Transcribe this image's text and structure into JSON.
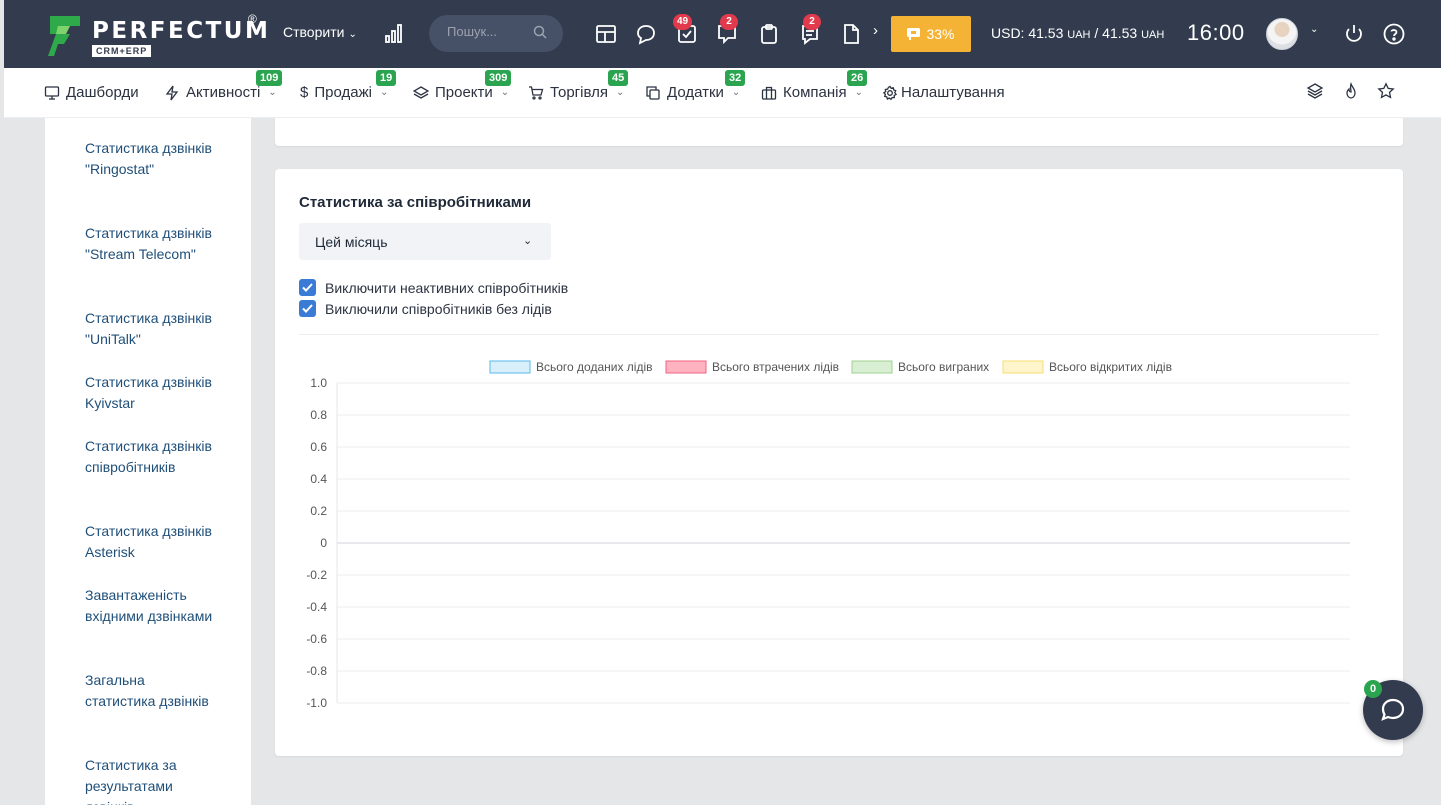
{
  "topbar": {
    "logo_text": "PERFECTUM",
    "logo_reg": "®",
    "logo_sub": "CRM+ERP",
    "create_label": "Створити",
    "search_placeholder": "Пошук...",
    "tasks_badge": "49",
    "chat_badge": "2",
    "notes_badge": "2",
    "progress_label": "33%",
    "currency_prefix": "USD: 41.53 ",
    "currency_unit1": "UAH",
    "currency_mid": " / 41.53 ",
    "currency_unit2": "UAH",
    "clock": "16:00"
  },
  "nav": {
    "items": [
      {
        "label": "Дашборди",
        "icon": "monitor-icon"
      },
      {
        "label": "Активності",
        "badge": "109",
        "icon": "bolt-icon"
      },
      {
        "label": "Продажі",
        "badge": "19",
        "icon": "dollar-icon"
      },
      {
        "label": "Проекти",
        "badge": "309",
        "icon": "layers-icon"
      },
      {
        "label": "Торгівля",
        "badge": "45",
        "icon": "cart-icon"
      },
      {
        "label": "Додатки",
        "badge": "32",
        "icon": "copy-icon"
      },
      {
        "label": "Компанія",
        "badge": "26",
        "icon": "building-icon"
      },
      {
        "label": "Налаштування",
        "icon": "gear-icon"
      }
    ]
  },
  "sidebar": {
    "links": [
      "Статистика дзвінків \"Ringostat\"",
      "Статистика дзвінків \"Stream Telecom\"",
      "Статистика дзвінків \"UniTalk\"",
      "Статистика дзвінків Kyivstar",
      "Статистика дзвінків співробітників",
      "Статистика дзвінків Asterisk",
      "Завантаженість вхідними дзвінками",
      "Загальна статистика дзвінків",
      "Статистика за результатами дзвінків"
    ]
  },
  "main": {
    "section_title": "Статистика за співробітниками",
    "period_selected": "Цей місяць",
    "checkbox_inactive": "Виключити неактивних співробітників",
    "checkbox_no_leads": "Виключили співробітників без лідів"
  },
  "chart_data": {
    "type": "bar",
    "categories": [],
    "ylim": [
      -1.0,
      1.0
    ],
    "yticks": [
      "1.0",
      "0.8",
      "0.6",
      "0.4",
      "0.2",
      "0",
      "-0.2",
      "-0.4",
      "-0.6",
      "-0.8",
      "-1.0"
    ],
    "grid": true,
    "legend_position": "top",
    "series": [
      {
        "name": "Всього доданих лідів",
        "values": [],
        "fill": "#d9f0fb",
        "stroke": "#5ab7e8"
      },
      {
        "name": "Всього втрачених лідів",
        "values": [],
        "fill": "#ffb3c1",
        "stroke": "#f06383"
      },
      {
        "name": "Всього виграних",
        "values": [],
        "fill": "#d8efd3",
        "stroke": "#9fd28f"
      },
      {
        "name": "Всього відкритих лідів",
        "values": [],
        "fill": "#fff5cc",
        "stroke": "#f7dd72"
      }
    ]
  },
  "chat_widget": {
    "badge": "0"
  },
  "colors": {
    "topbar_bg": "#333c4e",
    "accent_orange": "#f5b335",
    "badge_red": "#e03a4c",
    "badge_green": "#2aa44f",
    "checkbox_blue": "#3a7bd5",
    "link_blue": "#1f4f79"
  }
}
